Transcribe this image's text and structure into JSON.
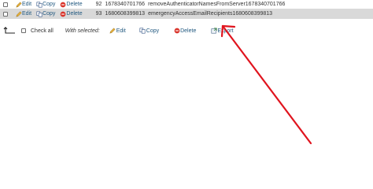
{
  "rows": [
    {
      "edit": "Edit",
      "copy": "Copy",
      "delete": "Delete",
      "id": "92",
      "value": "1678340701766",
      "name": "removeAuthenticatorNamesFromServer1678340701766"
    },
    {
      "edit": "Edit",
      "copy": "Copy",
      "delete": "Delete",
      "id": "93",
      "value": "1680608399813",
      "name": "emergencyAccessEmailRecipients1680608399813"
    }
  ],
  "bulk": {
    "check_all": "Check all",
    "with_selected": "With selected:",
    "edit": "Edit",
    "copy": "Copy",
    "delete": "Delete",
    "export": "Export"
  },
  "colors": {
    "link": "#235a81",
    "highlight_row": "#d9d9d9",
    "annotation": "#e0141e",
    "delete_icon": "#d9342b"
  }
}
